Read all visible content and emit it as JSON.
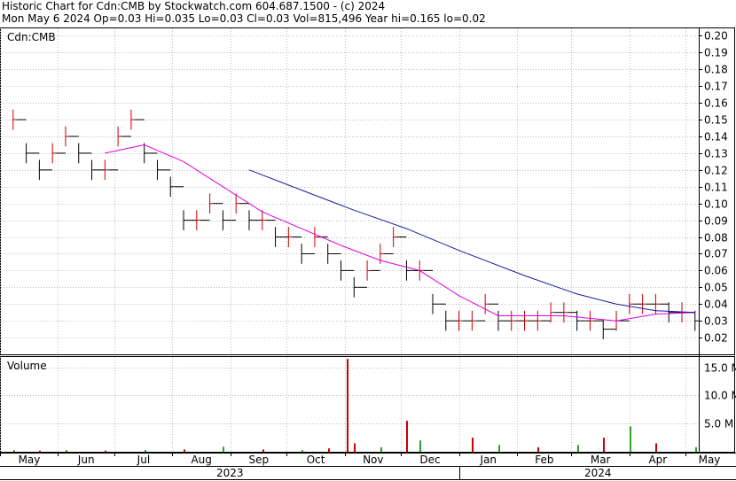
{
  "header": {
    "line1": "Historic Chart for Cdn:CMB by Stockwatch.com 604.687.1500 - (c) 2024",
    "line2": "Mon May  6 2024   Op=0.03   Hi=0.035   Lo=0.03   Cl=0.03   Vol=815,496   Year hi=0.165   lo=0.02"
  },
  "panels": {
    "price_label": "Cdn:CMB",
    "volume_label": "Volume"
  },
  "colors": {
    "up_bar": "#cc0000",
    "down_bar": "#000000",
    "ma_short": "#e000e0",
    "ma_long": "#1a1aa0",
    "volume_up": "#2e9e2e",
    "volume_down": "#cc0000"
  },
  "chart_data": {
    "type": "line",
    "price_axis": {
      "ylim": [
        0.01,
        0.205
      ],
      "ticks": [
        "0.20",
        "0.19",
        "0.18",
        "0.17",
        "0.16",
        "0.15",
        "0.14",
        "0.13",
        "0.12",
        "0.11",
        "0.10",
        "0.09",
        "0.08",
        "0.07",
        "0.06",
        "0.05",
        "0.04",
        "0.03",
        "0.02"
      ],
      "tick_values": [
        0.2,
        0.19,
        0.18,
        0.17,
        0.16,
        0.15,
        0.14,
        0.13,
        0.12,
        0.11,
        0.1,
        0.09,
        0.08,
        0.07,
        0.06,
        0.05,
        0.04,
        0.03,
        0.02
      ]
    },
    "volume_axis": {
      "ylim": [
        0,
        17
      ],
      "ticks": [
        "15.0 M",
        "10.0 M",
        "5.0 M"
      ],
      "tick_values": [
        15,
        10,
        5
      ]
    },
    "months": [
      "May",
      "Jun",
      "Jul",
      "Aug",
      "Sep",
      "Oct",
      "Nov",
      "Dec",
      "Jan",
      "Feb",
      "Mar",
      "Apr",
      "May"
    ],
    "years": [
      "2023",
      "2024"
    ],
    "series": [
      {
        "name": "",
        "kind": "close",
        "points": [
          [
            "2023-05-08",
            0.15
          ],
          [
            "2023-05-15",
            0.13
          ],
          [
            "2023-05-22",
            0.12
          ],
          [
            "2023-05-29",
            0.13
          ],
          [
            "2023-06-05",
            0.14
          ],
          [
            "2023-06-12",
            0.13
          ],
          [
            "2023-06-19",
            0.12
          ],
          [
            "2023-06-26",
            0.12
          ],
          [
            "2023-07-03",
            0.14
          ],
          [
            "2023-07-10",
            0.15
          ],
          [
            "2023-07-17",
            0.13
          ],
          [
            "2023-07-24",
            0.12
          ],
          [
            "2023-07-31",
            0.11
          ],
          [
            "2023-08-07",
            0.09
          ],
          [
            "2023-08-14",
            0.09
          ],
          [
            "2023-08-21",
            0.1
          ],
          [
            "2023-08-28",
            0.09
          ],
          [
            "2023-09-04",
            0.1
          ],
          [
            "2023-09-11",
            0.09
          ],
          [
            "2023-09-18",
            0.09
          ],
          [
            "2023-09-25",
            0.08
          ],
          [
            "2023-10-02",
            0.08
          ],
          [
            "2023-10-09",
            0.07
          ],
          [
            "2023-10-16",
            0.08
          ],
          [
            "2023-10-23",
            0.07
          ],
          [
            "2023-10-30",
            0.06
          ],
          [
            "2023-11-06",
            0.05
          ],
          [
            "2023-11-13",
            0.06
          ],
          [
            "2023-11-20",
            0.07
          ],
          [
            "2023-11-27",
            0.08
          ],
          [
            "2023-12-04",
            0.06
          ],
          [
            "2023-12-11",
            0.06
          ],
          [
            "2023-12-18",
            0.04
          ],
          [
            "2023-12-25",
            0.03
          ],
          [
            "2024-01-01",
            0.03
          ],
          [
            "2024-01-08",
            0.03
          ],
          [
            "2024-01-15",
            0.04
          ],
          [
            "2024-01-22",
            0.03
          ],
          [
            "2024-01-29",
            0.03
          ],
          [
            "2024-02-05",
            0.03
          ],
          [
            "2024-02-12",
            0.03
          ],
          [
            "2024-02-19",
            0.035
          ],
          [
            "2024-02-26",
            0.035
          ],
          [
            "2024-03-04",
            0.03
          ],
          [
            "2024-03-11",
            0.03
          ],
          [
            "2024-03-18",
            0.025
          ],
          [
            "2024-03-25",
            0.03
          ],
          [
            "2024-04-01",
            0.04
          ],
          [
            "2024-04-08",
            0.04
          ],
          [
            "2024-04-15",
            0.04
          ],
          [
            "2024-04-22",
            0.035
          ],
          [
            "2024-04-29",
            0.035
          ],
          [
            "2024-05-06",
            0.03
          ]
        ]
      },
      {
        "name": "",
        "kind": "ma_short",
        "points": [
          [
            "2023-06-26",
            0.13
          ],
          [
            "2023-07-17",
            0.135
          ],
          [
            "2023-08-07",
            0.125
          ],
          [
            "2023-08-28",
            0.11
          ],
          [
            "2023-09-18",
            0.095
          ],
          [
            "2023-10-09",
            0.085
          ],
          [
            "2023-10-30",
            0.075
          ],
          [
            "2023-11-20",
            0.066
          ],
          [
            "2023-12-11",
            0.06
          ],
          [
            "2024-01-01",
            0.045
          ],
          [
            "2024-01-22",
            0.033
          ],
          [
            "2024-02-26",
            0.033
          ],
          [
            "2024-03-25",
            0.03
          ],
          [
            "2024-04-15",
            0.034
          ],
          [
            "2024-05-06",
            0.035
          ]
        ]
      },
      {
        "name": "",
        "kind": "ma_long",
        "points": [
          [
            "2023-09-11",
            0.12
          ],
          [
            "2023-10-09",
            0.108
          ],
          [
            "2023-11-06",
            0.096
          ],
          [
            "2023-12-04",
            0.085
          ],
          [
            "2024-01-01",
            0.072
          ],
          [
            "2024-02-05",
            0.057
          ],
          [
            "2024-03-04",
            0.046
          ],
          [
            "2024-03-25",
            0.04
          ],
          [
            "2024-04-15",
            0.036
          ],
          [
            "2024-05-06",
            0.035
          ]
        ]
      },
      {
        "name": "",
        "kind": "volume_millions",
        "points": [
          [
            "2023-05-08",
            0.3
          ],
          [
            "2023-05-22",
            0.2
          ],
          [
            "2023-06-05",
            0.3
          ],
          [
            "2023-06-26",
            0.2
          ],
          [
            "2023-07-17",
            0.3
          ],
          [
            "2023-08-07",
            0.4
          ],
          [
            "2023-08-28",
            0.9
          ],
          [
            "2023-09-18",
            0.4
          ],
          [
            "2023-10-09",
            0.3
          ],
          [
            "2023-10-23",
            0.6
          ],
          [
            "2023-11-02",
            16.5
          ],
          [
            "2023-11-06",
            1.5
          ],
          [
            "2023-11-20",
            0.8
          ],
          [
            "2023-12-04",
            5.5
          ],
          [
            "2023-12-11",
            2.0
          ],
          [
            "2024-01-08",
            2.5
          ],
          [
            "2024-01-22",
            1.2
          ],
          [
            "2024-02-12",
            0.8
          ],
          [
            "2024-03-04",
            1.2
          ],
          [
            "2024-03-18",
            2.5
          ],
          [
            "2024-04-01",
            4.5
          ],
          [
            "2024-04-15",
            1.5
          ],
          [
            "2024-05-06",
            0.8
          ]
        ]
      }
    ]
  }
}
